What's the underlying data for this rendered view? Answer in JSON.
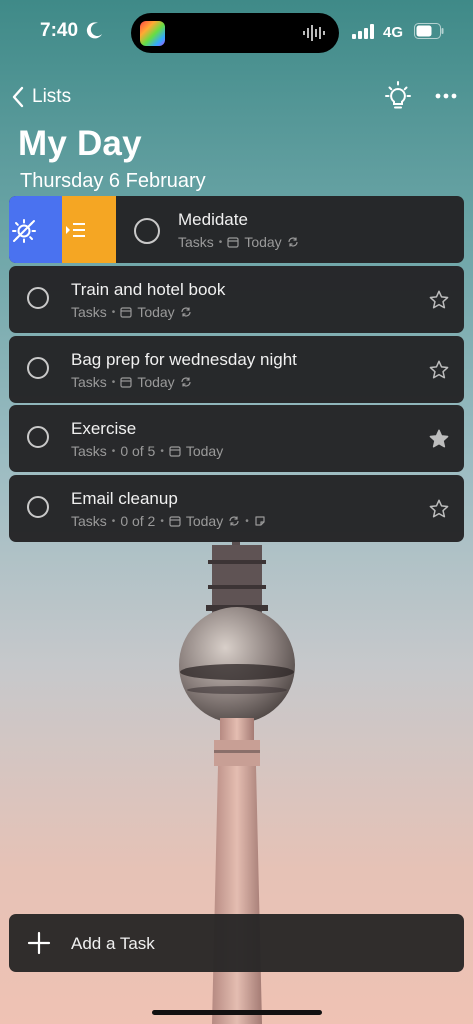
{
  "status": {
    "time": "7:40",
    "network": "4G"
  },
  "header": {
    "back_label": "Lists",
    "title": "My Day",
    "date": "Thursday 6 February"
  },
  "tasks": [
    {
      "title": "Medidate",
      "list": "Tasks",
      "due": "Today",
      "repeat": true,
      "starred": false,
      "swiped": true
    },
    {
      "title": "Train and hotel book",
      "list": "Tasks",
      "due": "Today",
      "repeat": true,
      "starred": false
    },
    {
      "title": "Bag prep for wednesday night",
      "list": "Tasks",
      "due": "Today",
      "repeat": true,
      "starred": false
    },
    {
      "title": "Exercise",
      "list": "Tasks",
      "steps": "0 of 5",
      "due": "Today",
      "repeat": false,
      "starred": true
    },
    {
      "title": "Email cleanup",
      "list": "Tasks",
      "steps": "0 of 2",
      "due": "Today",
      "repeat": true,
      "has_note": true,
      "starred": false
    }
  ],
  "add_task": {
    "label": "Add a Task"
  },
  "icons": {
    "swipe_left": "remove-from-my-day-icon",
    "swipe_right": "move-to-list-icon",
    "header_right": [
      "bulb-suggestions-icon",
      "more-icon"
    ]
  },
  "colors": {
    "swipe_blue": "#4a72f0",
    "swipe_orange": "#f5a623",
    "card": "#242426"
  }
}
